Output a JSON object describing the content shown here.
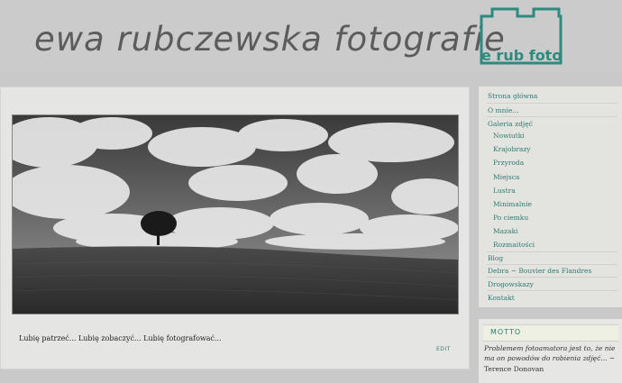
{
  "header": {
    "title": "ewa rubczewska fotografie",
    "logo_text": "e rub foto"
  },
  "main": {
    "tagline": "Lubię patrzeć... Lubię zobaczyć... Lubię fotografować...",
    "edit_label": "EDIT"
  },
  "sidebar": {
    "items": [
      {
        "label": "Strona główna",
        "level": 0
      },
      {
        "label": "O mnie...",
        "level": 0
      },
      {
        "label": "Galeria zdjęć",
        "level": 0
      },
      {
        "label": "Nowiutki",
        "level": 1
      },
      {
        "label": "Krajobrazy",
        "level": 1
      },
      {
        "label": "Przyroda",
        "level": 1
      },
      {
        "label": "Miejsca",
        "level": 1
      },
      {
        "label": "Lustra",
        "level": 1
      },
      {
        "label": "Minimalnie",
        "level": 1
      },
      {
        "label": "Po ciemku",
        "level": 1
      },
      {
        "label": "Mazaki",
        "level": 1
      },
      {
        "label": "Rozmaitości",
        "level": 1
      },
      {
        "label": "Blog",
        "level": 0
      },
      {
        "label": "Debra ~ Bouvier des Flandres",
        "level": 0
      },
      {
        "label": "Drogowskazy",
        "level": 0
      },
      {
        "label": "Kontakt",
        "level": 0
      }
    ]
  },
  "motto": {
    "title": "MOTTO",
    "quote": "Problemem fotoamatora jest to, że nie ma on powodów do robienia zdjęć... ~",
    "author": "Terence Donovan"
  },
  "colors": {
    "accent": "#2f7a70",
    "logo": "#2e8a7e",
    "background": "#c9c9c9"
  }
}
